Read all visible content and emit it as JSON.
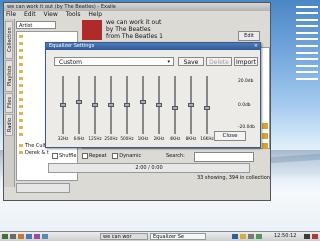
{
  "desktop": {
    "stats": [
      "",
      "",
      "",
      "",
      "",
      "",
      "",
      "",
      "",
      "",
      "",
      ""
    ]
  },
  "app": {
    "title": "we can work it out (by The Beatles) - Exaile",
    "menu": [
      "File",
      "Edit",
      "View",
      "Tools",
      "Help"
    ],
    "side_tabs": [
      "Collection",
      "Playlists",
      "Files",
      "Radio"
    ],
    "search_field": "Artist",
    "tree_items": [
      "The Cult",
      "Derek & t"
    ],
    "now_playing": {
      "title": "we can work it out",
      "artist": "by The Beatles",
      "album": "from The Beatles 1"
    },
    "edit_button": "Edit",
    "controls": {
      "shuffle": "Shuffle",
      "repeat": "Repeat",
      "dynamic": "Dynamic",
      "search_label": "Search:"
    },
    "progress_text": "2:00 / 0:00",
    "status": "33 showing, 394 in collection"
  },
  "equalizer": {
    "title": "Equalizer Settings",
    "preset": "Custom",
    "buttons": {
      "save": "Save",
      "delete": "Delete",
      "import": "Import",
      "close": "Close"
    },
    "bands": [
      {
        "label": "32Hz",
        "level": 0.5
      },
      {
        "label": "64Hz",
        "level": 0.55
      },
      {
        "label": "125Hz",
        "level": 0.5
      },
      {
        "label": "250Hz",
        "level": 0.5
      },
      {
        "label": "500Hz",
        "level": 0.5
      },
      {
        "label": "1KHz",
        "level": 0.55
      },
      {
        "label": "2KHz",
        "level": 0.5
      },
      {
        "label": "4KHz",
        "level": 0.45
      },
      {
        "label": "8KHz",
        "level": 0.5
      },
      {
        "label": "16KHz",
        "level": 0.45
      }
    ],
    "db_labels": [
      "20.0db",
      "0.0db",
      "-20.0db"
    ]
  },
  "taskbar": {
    "tasks": [
      "we can wor",
      "Equalizer Se"
    ],
    "clock": "12:50:12"
  }
}
